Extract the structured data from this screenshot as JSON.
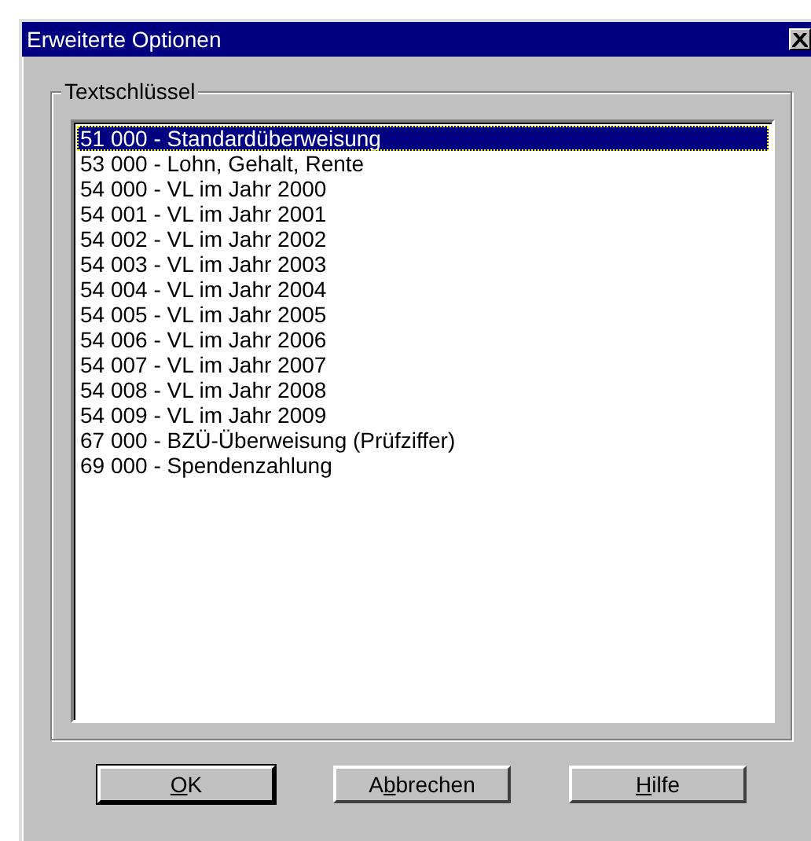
{
  "window": {
    "title": "Erweiterte Optionen"
  },
  "group": {
    "label": "Textschlüssel"
  },
  "list": [
    {
      "text": "51 000 - Standardüberweisung",
      "selected": true
    },
    {
      "text": "53 000 - Lohn, Gehalt, Rente",
      "selected": false
    },
    {
      "text": "54 000 - VL im Jahr 2000",
      "selected": false
    },
    {
      "text": "54 001 - VL im Jahr 2001",
      "selected": false
    },
    {
      "text": "54 002 - VL im Jahr 2002",
      "selected": false
    },
    {
      "text": "54 003 - VL im Jahr 2003",
      "selected": false
    },
    {
      "text": "54 004 - VL im Jahr 2004",
      "selected": false
    },
    {
      "text": "54 005 - VL im Jahr 2005",
      "selected": false
    },
    {
      "text": "54 006 - VL im Jahr 2006",
      "selected": false
    },
    {
      "text": "54 007 - VL im Jahr 2007",
      "selected": false
    },
    {
      "text": "54 008 - VL im Jahr 2008",
      "selected": false
    },
    {
      "text": "54 009 - VL im Jahr 2009",
      "selected": false
    },
    {
      "text": "67 000 - BZÜ-Überweisung (Prüfziffer)",
      "selected": false
    },
    {
      "text": "69 000 - Spendenzahlung",
      "selected": false
    }
  ],
  "buttons": [
    {
      "parts": [
        {
          "text": "O",
          "underlined": true
        },
        {
          "text": "K",
          "underlined": false
        }
      ],
      "default": true
    },
    {
      "parts": [
        {
          "text": "A",
          "underlined": false
        },
        {
          "text": "b",
          "underlined": true
        },
        {
          "text": "brechen",
          "underlined": false
        }
      ],
      "default": false
    },
    {
      "parts": [
        {
          "text": "H",
          "underlined": true
        },
        {
          "text": "ilfe",
          "underlined": false
        }
      ],
      "default": false
    }
  ]
}
